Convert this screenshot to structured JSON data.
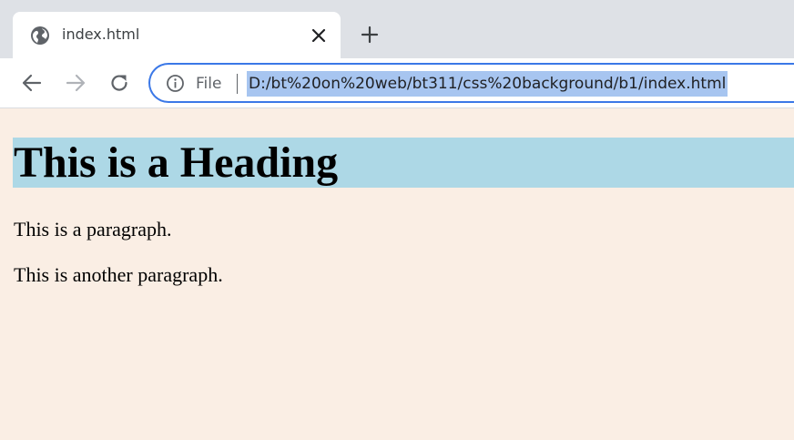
{
  "browser": {
    "tab": {
      "title": "index.html",
      "favicon_icon": "globe-icon",
      "close_icon": "close-icon"
    },
    "new_tab_icon": "plus-icon",
    "toolbar": {
      "back_icon": "arrow-left-icon",
      "forward_icon": "arrow-right-icon",
      "reload_icon": "reload-icon",
      "info_icon": "info-icon",
      "scheme_label": "File",
      "url": "D:/bt%20on%20web/bt311/css%20background/b1/index.html"
    }
  },
  "page": {
    "background_color": "#faeee4",
    "heading": {
      "text": "This is a Heading",
      "background_color": "#add8e6"
    },
    "paragraphs": [
      "This is a paragraph.",
      "This is another paragraph."
    ]
  },
  "colors": {
    "tabstrip": "#dee1e6",
    "omnibox_border": "#3b78e7",
    "url_selection": "#a7c5f0"
  }
}
